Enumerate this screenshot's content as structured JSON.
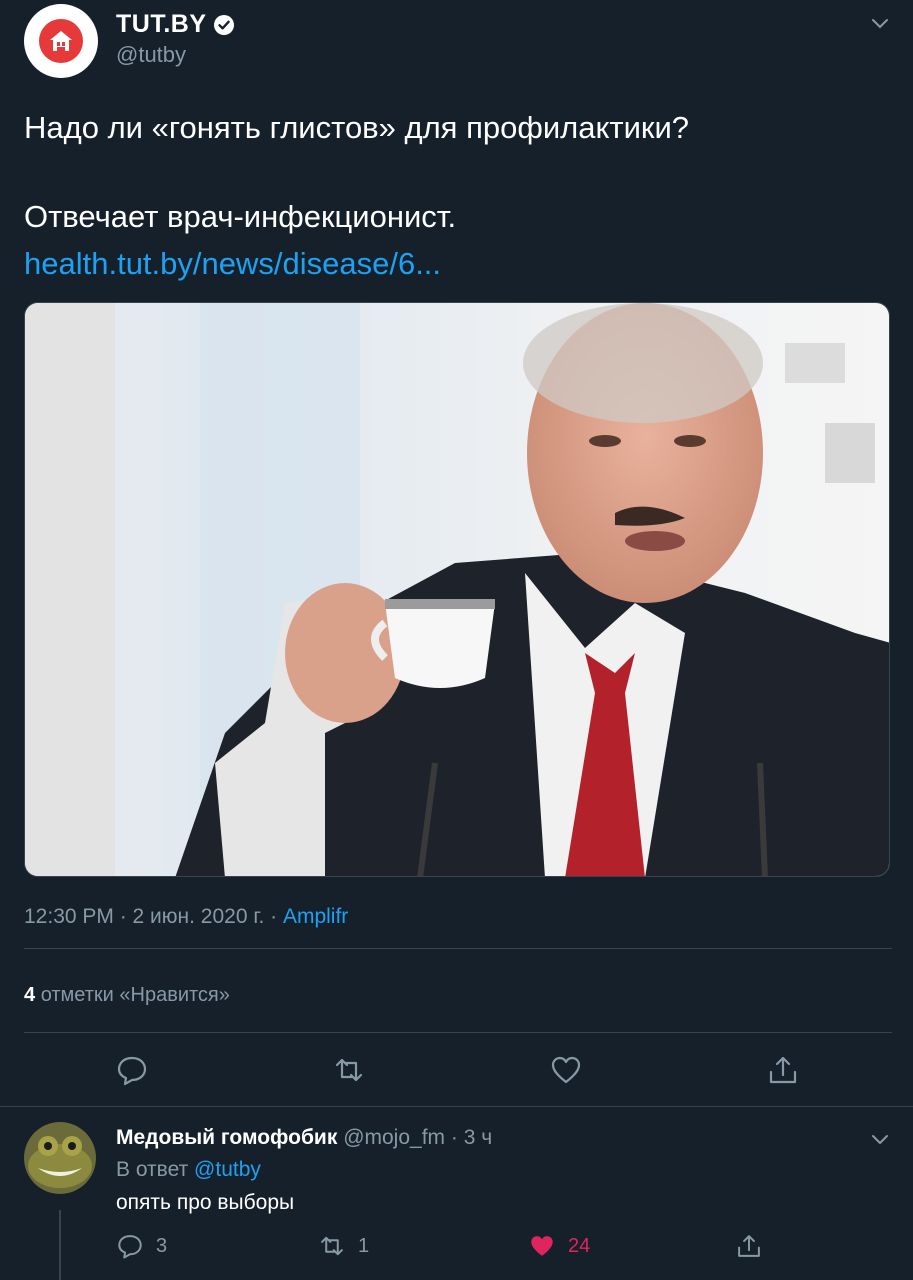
{
  "tweet": {
    "author_name": "TUT.BY",
    "author_handle": "@tutby",
    "text_line1": "Надо ли «гонять глистов» для профилактики?",
    "text_line2": "Отвечает врач-инфекционист.",
    "link": "health.tut.by/news/disease/6...",
    "meta_prefix": "12:30 PM · 2 июн. 2020 г. · ",
    "meta_source": "Amplifr",
    "likes_count": "4",
    "likes_label": "отметки «Нравится»"
  },
  "reply": {
    "author_name": "Медовый гомофобик",
    "author_meta": "@mojo_fm · 3 ч",
    "reply_prefix": "В ответ ",
    "reply_mention": "@tutby",
    "text": "опять про выборы",
    "reply_count": "3",
    "retweet_count": "1",
    "like_count": "24"
  },
  "colors": {
    "background": "#15202b",
    "link": "#1da1f2",
    "muted": "#8899a6",
    "like_active": "#e0245e",
    "divider": "#38444d"
  },
  "icons": [
    "home-logo-icon",
    "verified-badge-icon",
    "chevron-down-icon",
    "reply-icon",
    "retweet-icon",
    "like-icon",
    "share-icon"
  ]
}
